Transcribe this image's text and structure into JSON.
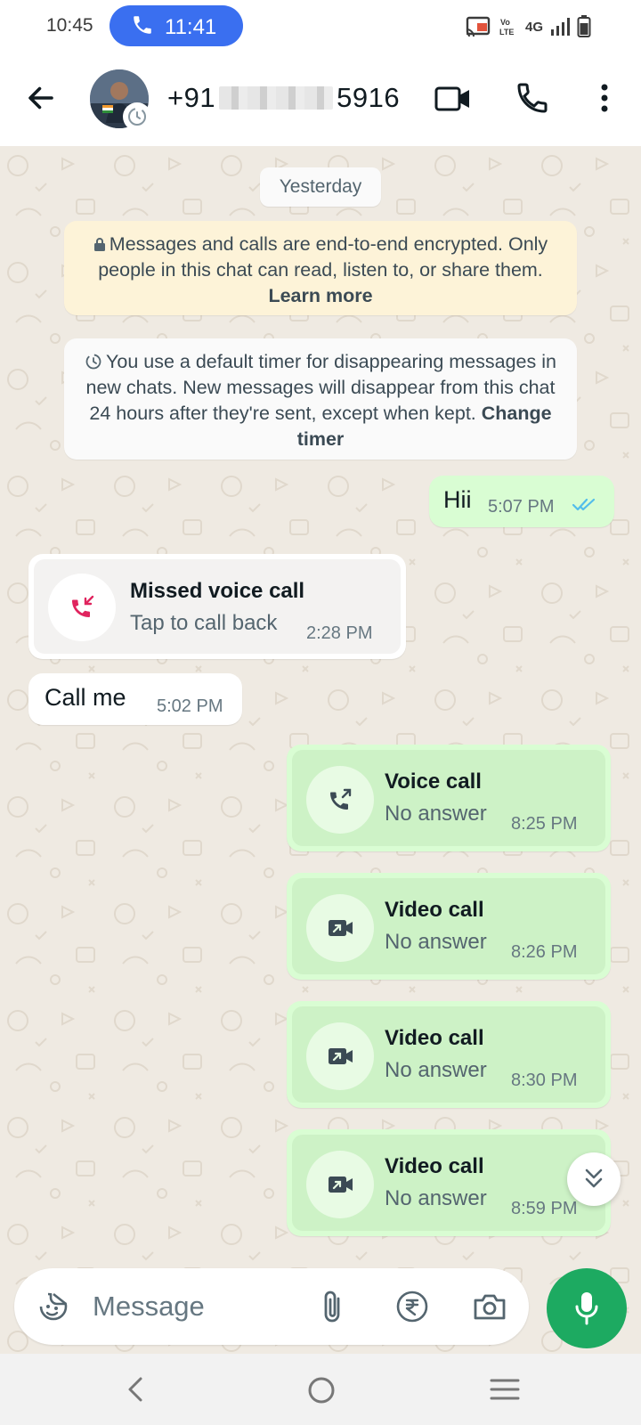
{
  "status_bar": {
    "time": "10:45",
    "call_timer": "11:41",
    "network": "4G"
  },
  "header": {
    "contact_prefix": "+91",
    "contact_suffix": "5916"
  },
  "chat": {
    "date_chip": "Yesterday",
    "encryption_notice": "Messages and calls are end-to-end encrypted. Only people in this chat can read, listen to, or share them.",
    "encryption_link": "Learn more",
    "timer_notice": "You use a default timer for disappearing messages in new chats. New messages will disappear from this chat 24 hours after they're sent, except when kept.",
    "timer_link": "Change timer",
    "messages": [
      {
        "text": "Hii",
        "time": "5:07 PM"
      },
      {
        "title": "Missed voice call",
        "subtitle": "Tap to call back",
        "time": "2:28 PM"
      },
      {
        "text": "Call me",
        "time": "5:02 PM"
      },
      {
        "title": "Voice call",
        "subtitle": "No answer",
        "time": "8:25 PM"
      },
      {
        "title": "Video call",
        "subtitle": "No answer",
        "time": "8:26 PM"
      },
      {
        "title": "Video call",
        "subtitle": "No answer",
        "time": "8:30 PM"
      },
      {
        "title": "Video call",
        "subtitle": "No answer",
        "time": "8:59 PM"
      }
    ]
  },
  "composer": {
    "placeholder": "Message"
  },
  "colors": {
    "accent": "#1daa61",
    "outgoing_bubble": "#d9fdd3",
    "chat_background": "#efeae2",
    "missed_call": "#e0245e",
    "read_ticks": "#53bdeb"
  }
}
